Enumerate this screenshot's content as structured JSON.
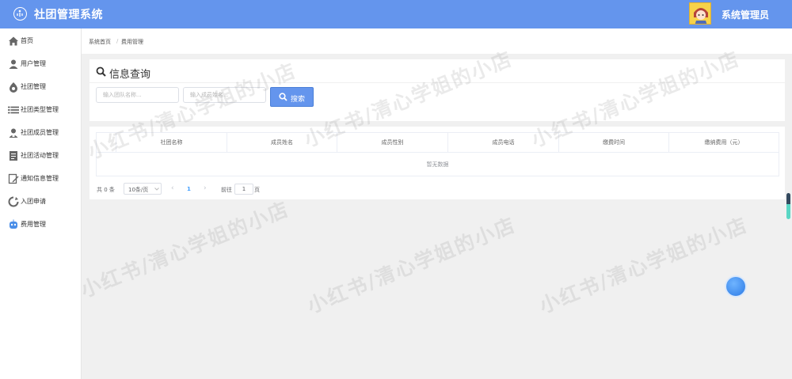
{
  "header": {
    "app_title": "社团管理系统",
    "user_name": "系统管理员"
  },
  "sidebar": {
    "items": [
      {
        "label": "首页",
        "icon": "home-icon"
      },
      {
        "label": "用户管理",
        "icon": "user-icon"
      },
      {
        "label": "社团管理",
        "icon": "drop-icon"
      },
      {
        "label": "社团类型管理",
        "icon": "list-icon"
      },
      {
        "label": "社团成员管理",
        "icon": "member-icon"
      },
      {
        "label": "社团活动管理",
        "icon": "document-icon"
      },
      {
        "label": "通知信息管理",
        "icon": "edit-icon"
      },
      {
        "label": "入团申请",
        "icon": "cycle-icon"
      },
      {
        "label": "费用管理",
        "icon": "robot-icon"
      }
    ]
  },
  "breadcrumb": {
    "home": "系统首页",
    "separator": "/",
    "current": "费用管理"
  },
  "panel": {
    "title": "信息查询"
  },
  "search": {
    "team_placeholder": "输入团队名称...",
    "member_placeholder": "输入成员姓名...",
    "button_label": "搜索"
  },
  "table": {
    "columns": [
      "社团名称",
      "成员姓名",
      "成员性别",
      "成员电话",
      "缴费时间",
      "缴纳费用（元）"
    ],
    "empty_text": "暂无数据"
  },
  "pagination": {
    "total": "共 0 条",
    "page_size": "10条/页",
    "prev": "‹",
    "current_page": "1",
    "next": "›",
    "goto_label": "前往",
    "goto_value": "1",
    "page_suffix": "页"
  },
  "watermark": {
    "text": "小红书/清心学姐的小店"
  },
  "colors": {
    "primary": "#6495ed",
    "sidebar_bg": "#ffffff",
    "page_bg": "#f0f0f0"
  }
}
